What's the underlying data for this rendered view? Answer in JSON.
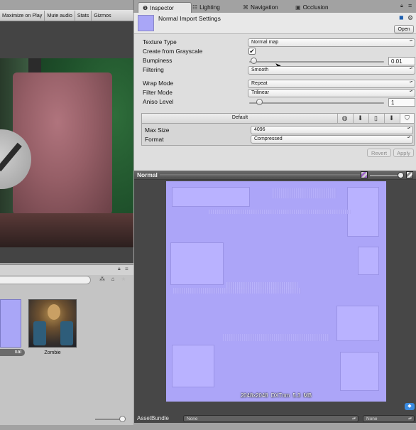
{
  "game_toolbar": {
    "maximize_on_play": "Maximize on Play",
    "mute_audio": "Mute audio",
    "stats": "Stats",
    "gizmos": "Gizmos"
  },
  "tabs": [
    {
      "label": "Inspector",
      "icon": "info-icon"
    },
    {
      "label": "Lighting",
      "icon": "lighting-icon"
    },
    {
      "label": "Navigation",
      "icon": "navigation-icon"
    },
    {
      "label": "Occlusion",
      "icon": "occlusion-icon"
    }
  ],
  "inspector": {
    "title": "Normal Import Settings",
    "open_label": "Open",
    "texture_type": {
      "label": "Texture Type",
      "value": "Normal map"
    },
    "create_from_grayscale": {
      "label": "Create from Grayscale",
      "checked": true,
      "check_glyph": "✔"
    },
    "bumpiness": {
      "label": "Bumpiness",
      "value": "0.01",
      "level": 0.03
    },
    "filtering": {
      "label": "Filtering",
      "value": "Smooth"
    },
    "wrap_mode": {
      "label": "Wrap Mode",
      "value": "Repeat"
    },
    "filter_mode": {
      "label": "Filter Mode",
      "value": "Trilinear"
    },
    "aniso_level": {
      "label": "Aniso Level",
      "value": "1",
      "level": 0.06
    },
    "platform": {
      "default_label": "Default",
      "icons": [
        "web-icon",
        "standalone-icon",
        "mobile-icon",
        "download-icon",
        "html5-icon"
      ],
      "max_size": {
        "label": "Max Size",
        "value": "4096"
      },
      "format": {
        "label": "Format",
        "value": "Compressed"
      }
    },
    "revert_label": "Revert",
    "apply_label": "Apply"
  },
  "preview": {
    "title": "Normal",
    "info": "2048x2048  DXTnm   5.3 MB"
  },
  "project": {
    "assets": [
      {
        "label": "nal"
      },
      {
        "label": "Zombie"
      }
    ]
  },
  "assetbundle": {
    "label": "AssetBundle",
    "name_value": "None",
    "variant_value": "None"
  },
  "colors": {
    "normal_map": "#aca5f8",
    "accent_blue": "#3b8be0"
  }
}
